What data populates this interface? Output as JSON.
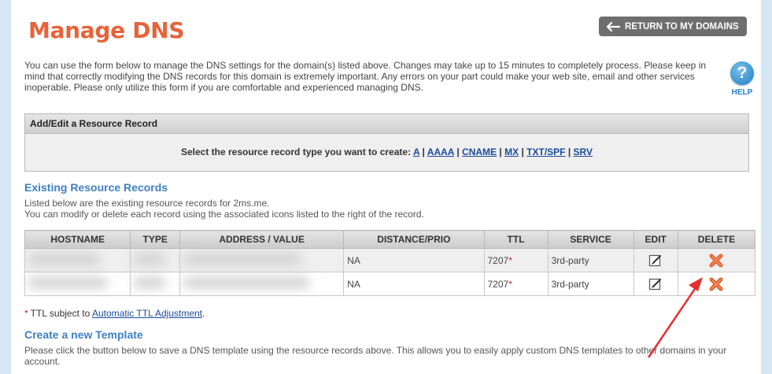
{
  "header": {
    "title": "Manage DNS",
    "return_button": "RETURN TO MY DOMAINS"
  },
  "intro": "You can use the form below to manage the DNS settings for the domain(s) listed above. Changes may take up to 15 minutes to completely process. Please keep in mind that correctly modifying the DNS records for this domain is extremely important. Any errors on your part could make your web site, email and other services inoperable. Please only utilize this form if you are comfortable and experienced managing DNS.",
  "help": {
    "label": "HELP",
    "icon": "question-icon"
  },
  "add_edit": {
    "header": "Add/Edit a Resource Record",
    "prompt": "Select the resource record type you want to create:",
    "types": [
      "A",
      "AAAA",
      "CNAME",
      "MX",
      "TXT/SPF",
      "SRV"
    ]
  },
  "existing": {
    "title": "Existing Resource Records",
    "line1": "Listed below are the existing resource records for 2ms.me.",
    "line2": "You can modify or delete each record using the associated icons listed to the right of the record.",
    "columns": [
      "HOSTNAME",
      "TYPE",
      "ADDRESS / VALUE",
      "DISTANCE/PRIO",
      "TTL",
      "SERVICE",
      "EDIT",
      "DELETE"
    ],
    "rows": [
      {
        "distance": "NA",
        "ttl": "7207",
        "ttl_mark": "*",
        "service": "3rd-party"
      },
      {
        "distance": "NA",
        "ttl": "7207",
        "ttl_mark": "*",
        "service": "3rd-party"
      }
    ]
  },
  "ttl_note": {
    "mark": "*",
    "text": "TTL subject to",
    "link": "Automatic TTL Adjustment",
    "end": "."
  },
  "template": {
    "title": "Create a new Template",
    "text": "Please click the button below to save a DNS template using the resource records above. This allows you to easily apply custom DNS templates to other domains in your account."
  },
  "colors": {
    "title": "#e8623a",
    "section_title": "#3f7fc1",
    "link": "#1a4a9c",
    "delete_icon": "#e05a2a",
    "annotation_arrow": "#e53030"
  }
}
